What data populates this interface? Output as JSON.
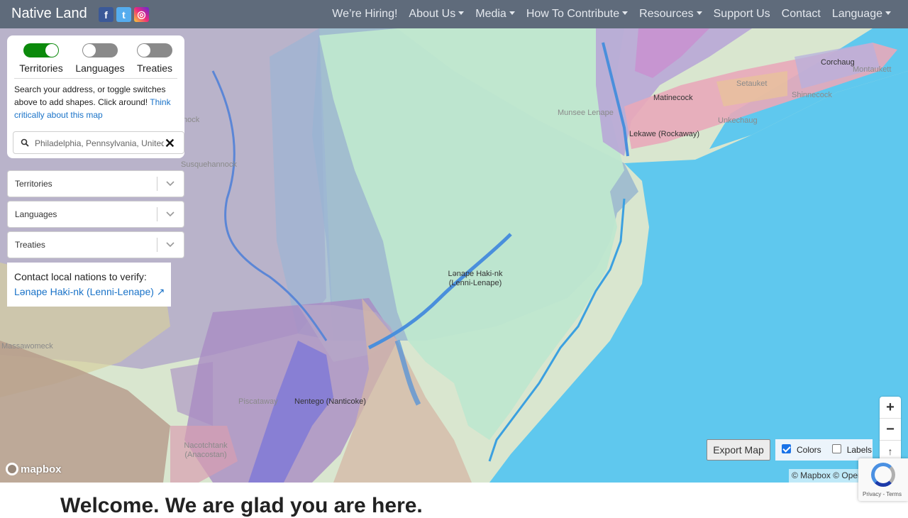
{
  "navbar": {
    "brand": "Native Land",
    "social": {
      "facebook": "f",
      "twitter": "t",
      "instagram": "◎"
    },
    "links": [
      {
        "label": "We’re Hiring!",
        "dropdown": false
      },
      {
        "label": "About Us",
        "dropdown": true
      },
      {
        "label": "Media",
        "dropdown": true
      },
      {
        "label": "How To Contribute",
        "dropdown": true
      },
      {
        "label": "Resources",
        "dropdown": true
      },
      {
        "label": "Support Us",
        "dropdown": false
      },
      {
        "label": "Contact",
        "dropdown": false
      },
      {
        "label": "Language",
        "dropdown": true
      }
    ]
  },
  "panel": {
    "toggles": [
      {
        "label": "Territories",
        "on": true
      },
      {
        "label": "Languages",
        "on": false
      },
      {
        "label": "Treaties",
        "on": false
      }
    ],
    "help_text": "Search your address, or toggle switches above to add shapes. Click around!",
    "help_link": "Think critically about this map",
    "search_placeholder": "Philadelphia, Pennsylvania, United States",
    "clear_symbol": "✕"
  },
  "selects": [
    {
      "label": "Territories"
    },
    {
      "label": "Languages"
    },
    {
      "label": "Treaties"
    }
  ],
  "verify": {
    "title": "Contact local nations to verify:",
    "link": "Lənape Haki-nk (Lenni-Lenape) ↗"
  },
  "map_labels": [
    "nock",
    "Susquehannock",
    "Munsee Lenape",
    "Matinecock",
    "Setauket",
    "Corchaug",
    "Montaukett",
    "Shinnecock",
    "Unkechaug",
    "Lekawe (Rockaway)",
    "Lənape Haki-nk (Lenni-Lenape)",
    "Nentego (Nanticoke)",
    "Piscataway",
    "Nacotchtank (Anacostan)",
    "Massawomeck"
  ],
  "controls": {
    "zoom_in": "+",
    "zoom_out": "−",
    "reset": "↑",
    "export": "Export Map",
    "colors_label": "Colors",
    "colors_checked": true,
    "labels_label": "Labels",
    "labels_checked": false,
    "attribution": "© Mapbox © OpenStreetMap",
    "mapbox_logo": "mapbox",
    "recaptcha": "Privacy - Terms"
  },
  "welcome": "Welcome. We are glad you are here."
}
